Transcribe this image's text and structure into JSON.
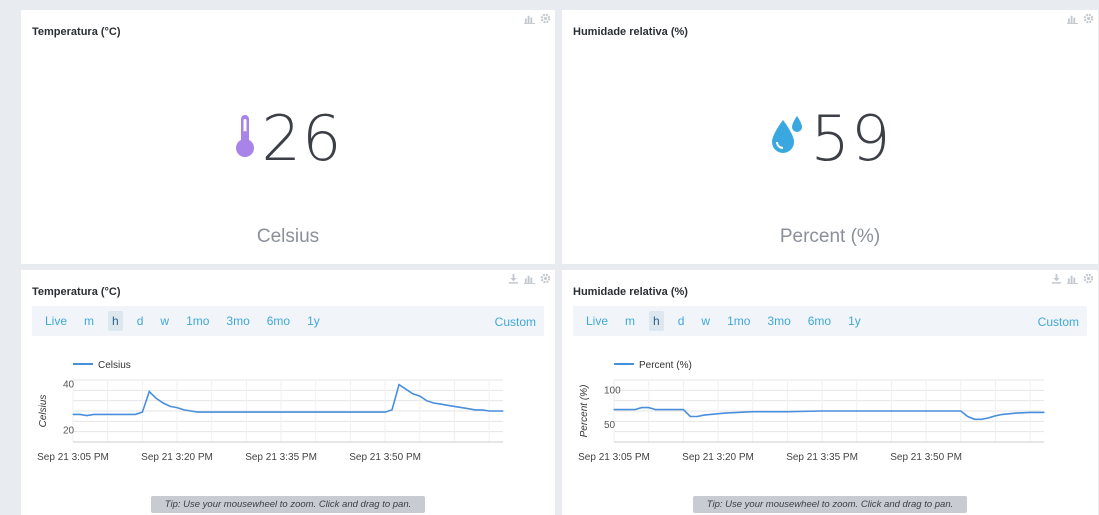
{
  "colors": {
    "accent": "#41a9d6",
    "series": "#4a8fdc",
    "thermo": "#a883e8",
    "drop": "#3aa8e0"
  },
  "tiles": {
    "temperature": {
      "title": "Temperatura (°C)",
      "value": "26",
      "unit": "Celsius",
      "icon": "thermometer-icon"
    },
    "humidity": {
      "title": "Humidade relativa (%)",
      "value": "59",
      "unit": "Percent (%)",
      "icon": "water-drop-icon"
    }
  },
  "range_options": [
    "Live",
    "m",
    "h",
    "d",
    "w",
    "1mo",
    "3mo",
    "6mo",
    "1y"
  ],
  "range_active": "h",
  "range_custom": "Custom",
  "tip": "Tip: Use your mousewheel to zoom. Click and drag to pan.",
  "charts": {
    "temperature": {
      "title": "Temperatura (°C)",
      "legend": "Celsius",
      "ylabel": "Celsius"
    },
    "humidity": {
      "title": "Humidade relativa (%)",
      "legend": "Percent (%)",
      "ylabel": "Percent (%)"
    }
  },
  "chart_data": [
    {
      "type": "line",
      "title": "Temperatura (°C)",
      "ylabel": "Celsius",
      "xlabel": "",
      "ylim": [
        15,
        42
      ],
      "yticks": [
        20,
        40
      ],
      "xlim": [
        0,
        62
      ],
      "xticks": [
        {
          "x": 0,
          "label": "Sep 21 3:05 PM"
        },
        {
          "x": 15,
          "label": "Sep 21 3:20 PM"
        },
        {
          "x": 30,
          "label": "Sep 21 3:35 PM"
        },
        {
          "x": 45,
          "label": "Sep 21 3:50 PM"
        }
      ],
      "grid": true,
      "legend": "top-left",
      "series": [
        {
          "name": "Celsius",
          "x": [
            0,
            1,
            2,
            3,
            4,
            5,
            8,
            9,
            10,
            11,
            12,
            13,
            14,
            15,
            16,
            17,
            18,
            19,
            20,
            30,
            40,
            44,
            45,
            46,
            47,
            48,
            49,
            50,
            51,
            52,
            53,
            54,
            55,
            56,
            57,
            58,
            59,
            60,
            61,
            62
          ],
          "y": [
            27,
            27,
            26.5,
            27,
            27,
            27,
            27,
            27,
            28,
            37,
            34,
            32,
            30.5,
            30,
            29,
            28.5,
            28,
            28,
            28,
            28,
            28,
            28,
            28,
            29,
            40,
            38,
            36,
            35,
            33,
            32,
            31.5,
            31,
            30.5,
            30,
            29.5,
            29,
            29,
            28.5,
            28.5,
            28.5
          ]
        }
      ]
    },
    {
      "type": "line",
      "title": "Humidade relativa (%)",
      "ylabel": "Percent (%)",
      "xlabel": "",
      "ylim": [
        25,
        115
      ],
      "yticks": [
        50,
        100
      ],
      "xlim": [
        0,
        62
      ],
      "xticks": [
        {
          "x": 0,
          "label": "Sep 21 3:05 PM"
        },
        {
          "x": 15,
          "label": "Sep 21 3:20 PM"
        },
        {
          "x": 30,
          "label": "Sep 21 3:35 PM"
        },
        {
          "x": 45,
          "label": "Sep 21 3:50 PM"
        }
      ],
      "grid": true,
      "legend": "top-left",
      "series": [
        {
          "name": "Percent (%)",
          "x": [
            0,
            3,
            4,
            5,
            6,
            7,
            10,
            11,
            12,
            13,
            16,
            20,
            25,
            30,
            35,
            40,
            45,
            49,
            50,
            51,
            52,
            53,
            54,
            55,
            56,
            58,
            60,
            62
          ],
          "y": [
            72,
            72,
            75,
            75,
            72,
            72,
            72,
            62,
            62,
            64,
            67,
            69,
            69,
            70,
            70,
            70,
            70,
            70,
            70,
            62,
            58,
            58,
            60,
            63,
            65,
            67,
            68,
            68
          ]
        }
      ]
    }
  ]
}
